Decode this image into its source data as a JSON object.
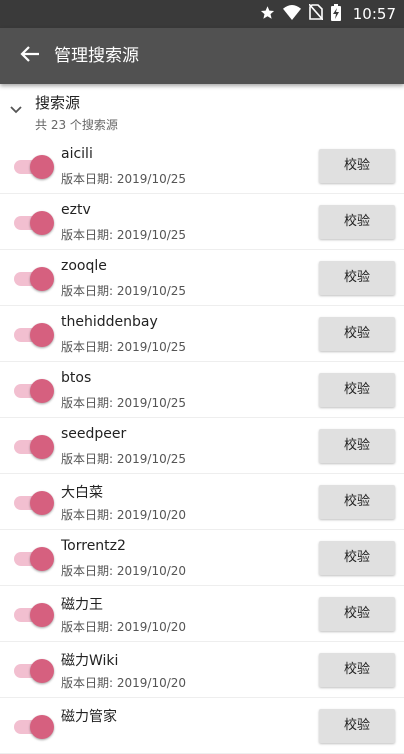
{
  "status_bar": {
    "time": "10:57",
    "icons": [
      "star-icon",
      "wifi-icon",
      "no-sim-icon",
      "battery-charging-icon"
    ]
  },
  "app_bar": {
    "back_icon": "arrow-back-icon",
    "title": "管理搜索源"
  },
  "group": {
    "title": "搜索源",
    "subtitle": "共 23 个搜索源",
    "expand_icon": "chevron-down-icon"
  },
  "colors": {
    "toggle_thumb": "#d6607f",
    "toggle_track": "#f2bfd0",
    "status_bar": "#3a3a3a",
    "app_bar": "#515151"
  },
  "sources": [
    {
      "name": "aicili",
      "date": "版本日期: 2019/10/25",
      "enabled": true,
      "button": "校验"
    },
    {
      "name": "eztv",
      "date": "版本日期: 2019/10/25",
      "enabled": true,
      "button": "校验"
    },
    {
      "name": "zooqle",
      "date": "版本日期: 2019/10/25",
      "enabled": true,
      "button": "校验"
    },
    {
      "name": "thehiddenbay",
      "date": "版本日期: 2019/10/25",
      "enabled": true,
      "button": "校验"
    },
    {
      "name": "btos",
      "date": "版本日期: 2019/10/25",
      "enabled": true,
      "button": "校验"
    },
    {
      "name": "seedpeer",
      "date": "版本日期: 2019/10/25",
      "enabled": true,
      "button": "校验"
    },
    {
      "name": "大白菜",
      "date": "版本日期: 2019/10/20",
      "enabled": true,
      "button": "校验"
    },
    {
      "name": "Torrentz2",
      "date": "版本日期: 2019/10/20",
      "enabled": true,
      "button": "校验"
    },
    {
      "name": "磁力王",
      "date": "版本日期: 2019/10/20",
      "enabled": true,
      "button": "校验"
    },
    {
      "name": "磁力Wiki",
      "date": "版本日期: 2019/10/20",
      "enabled": true,
      "button": "校验"
    },
    {
      "name": "磁力管家",
      "date": "",
      "enabled": true,
      "button": "校验"
    }
  ]
}
